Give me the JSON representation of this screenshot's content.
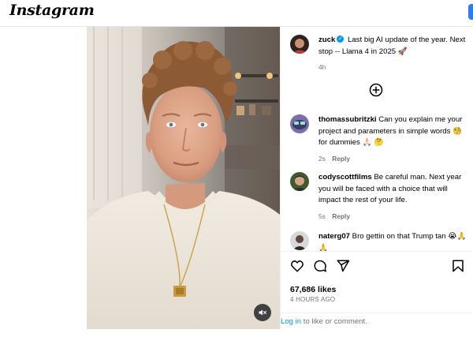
{
  "header": {
    "logo": "Instagram"
  },
  "post": {
    "caption": {
      "username": "zuck",
      "verified": true,
      "text": "Last big AI update of the year. Next stop -- Llama 4 in 2025",
      "emoji": "🚀",
      "time": "4h"
    },
    "comments": [
      {
        "username": "thomassubritzki",
        "text": "Can you explain me your project and parameters in simple words",
        "text_after": "for dummies",
        "emoji1": "🧐",
        "emoji2": "🙏🏻 🤔",
        "time": "2s",
        "reply_label": "Reply"
      },
      {
        "username": "codyscottfilms",
        "text": "Be careful man. Next year you will be faced with a choice that will impact the rest of your life.",
        "time": "5s",
        "reply_label": "Reply"
      },
      {
        "username": "naterg07",
        "text": "Bro gettin on that Trump tan",
        "emoji": "😭🙏🙏"
      }
    ],
    "likes": "67,686 likes",
    "posted": "4 hours ago",
    "login_link": "Log in",
    "login_rest": " to like or comment.",
    "icons": {
      "like": "heart-icon",
      "comment": "comment-icon",
      "share": "share-icon",
      "save": "bookmark-icon",
      "mute": "speaker-muted-icon",
      "more": "plus-circle-icon"
    },
    "colors": {
      "link": "#0095f6",
      "verified": "#0095f6",
      "meta": "#737373"
    }
  }
}
